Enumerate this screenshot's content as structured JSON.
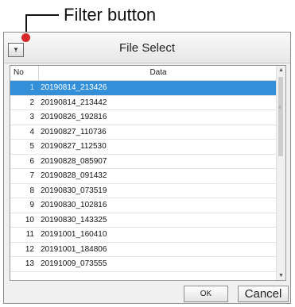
{
  "callout": {
    "label": "Filter button"
  },
  "dialog": {
    "title": "File Select",
    "filter_icon": "funnel-icon"
  },
  "list": {
    "columns": [
      "No",
      "Data"
    ],
    "selected_index": 0,
    "rows": [
      {
        "no": "1",
        "data": "20190814_213426"
      },
      {
        "no": "2",
        "data": "20190814_213442"
      },
      {
        "no": "3",
        "data": "20190826_192816"
      },
      {
        "no": "4",
        "data": "20190827_110736"
      },
      {
        "no": "5",
        "data": "20190827_112530"
      },
      {
        "no": "6",
        "data": "20190828_085907"
      },
      {
        "no": "7",
        "data": "20190828_091432"
      },
      {
        "no": "8",
        "data": "20190830_073519"
      },
      {
        "no": "9",
        "data": "20190830_102816"
      },
      {
        "no": "10",
        "data": "20190830_143325"
      },
      {
        "no": "11",
        "data": "20191001_160410"
      },
      {
        "no": "12",
        "data": "20191001_184806"
      },
      {
        "no": "13",
        "data": "20191009_073555"
      }
    ]
  },
  "buttons": {
    "ok": "OK",
    "cancel": "Cancel"
  },
  "colors": {
    "selection": "#3390d8",
    "callout_dot": "#d42a2a"
  }
}
